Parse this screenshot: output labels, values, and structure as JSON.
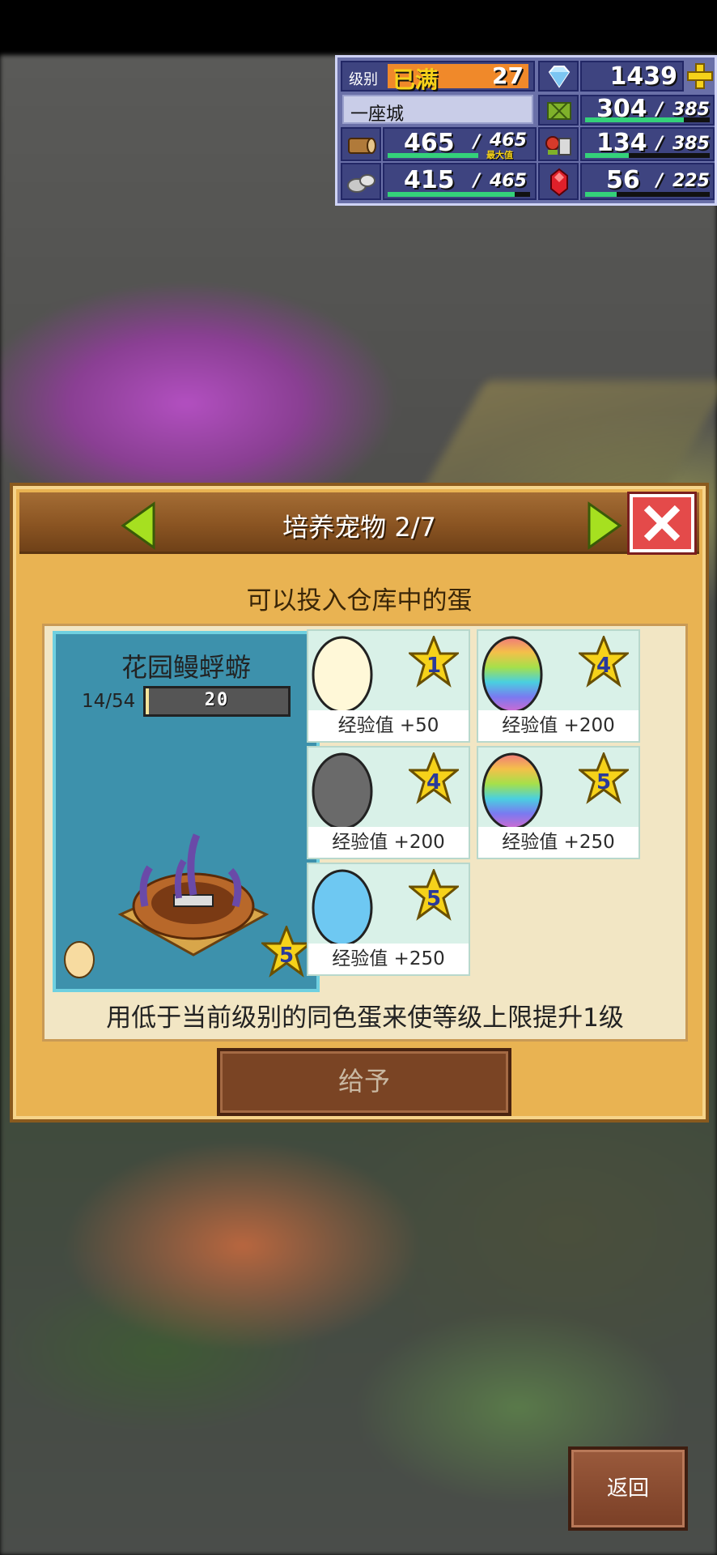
{
  "hud": {
    "level_label": "级别",
    "level_status": "已满",
    "level_value": "27",
    "gems": "1439",
    "city_name": "一座城",
    "wood": "465",
    "wood_max": "465",
    "wood_max_label": "最大值",
    "crop": "304",
    "crop_max": "385",
    "food": "134",
    "food_max": "385",
    "stone": "415",
    "stone_max": "465",
    "ruby": "56",
    "ruby_max": "225",
    "sep": "/"
  },
  "dialog": {
    "title": "培养宠物 2/7",
    "subtitle": "可以投入仓库中的蛋",
    "pet_name": "花园鳗蜉蝣",
    "pet_count": "14/54",
    "pet_level": "20",
    "pet_star": "5",
    "hint": "用低于当前级别的同色蛋来使等级上限提升1级",
    "give_label": "给予"
  },
  "eggs": [
    {
      "label": "经验值 +50",
      "star": "1",
      "color": "white"
    },
    {
      "label": "经验值 +200",
      "star": "4",
      "color": "rainbow"
    },
    {
      "label": "经验值 +200",
      "star": "4",
      "color": "black"
    },
    {
      "label": "经验值 +250",
      "star": "5",
      "color": "rainbow"
    },
    {
      "label": "经验值 +250",
      "star": "5",
      "color": "blue"
    }
  ],
  "nav": {
    "back_label": "返回"
  },
  "icons": {
    "prev": "arrow-left-icon",
    "next": "arrow-right-icon",
    "close": "close-icon",
    "gem": "diamond-icon",
    "plus": "plus-icon",
    "wood": "wood-log-icon",
    "crop": "crop-icon",
    "food": "food-icon",
    "stone": "stone-icon",
    "ruby": "ruby-icon",
    "star": "star-icon"
  },
  "colors": {
    "dialog_bg": "#e9b352",
    "title_bar": "#8a5422",
    "pet_panel": "#3d91ac",
    "close_red": "#e44a4a",
    "arrow_green": "#a6e020",
    "hud_bg": "#3e4480",
    "bar_green": "#34d17a"
  },
  "bars": {
    "crop_fill": 0.79,
    "food_fill": 0.35,
    "stone_fill": 0.89,
    "ruby_fill": 0.25,
    "wood_fill": 1.0
  }
}
